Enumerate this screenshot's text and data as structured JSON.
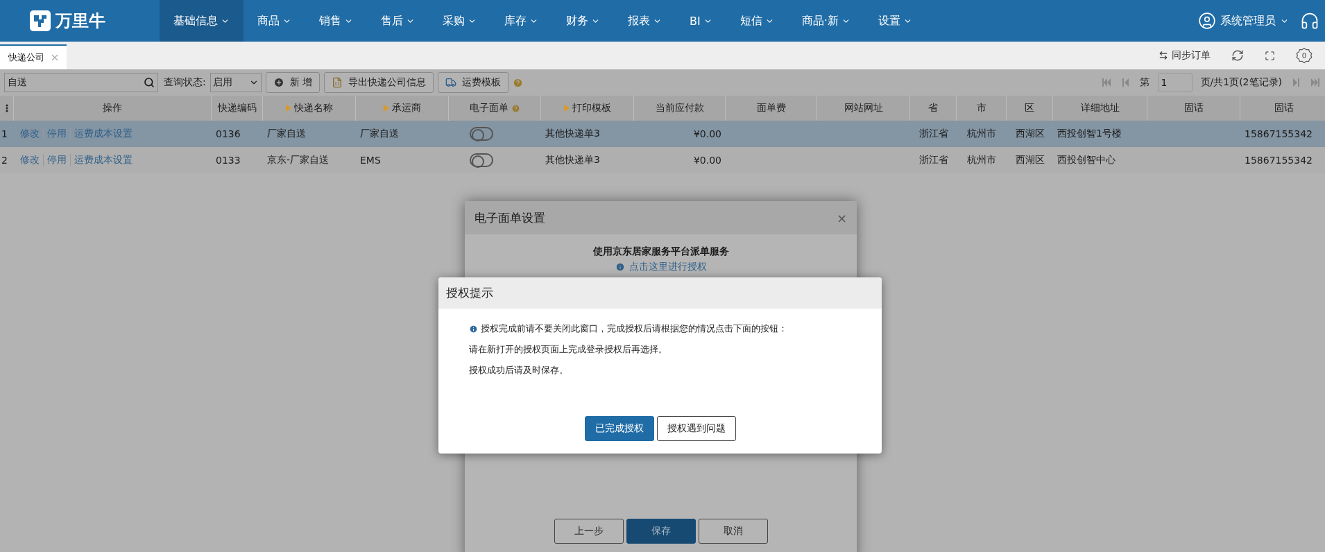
{
  "nav": {
    "logo": "万里牛",
    "items": [
      {
        "label": "基础信息",
        "selected": true
      },
      {
        "label": "商品",
        "selected": false
      },
      {
        "label": "销售",
        "selected": false
      },
      {
        "label": "售后",
        "selected": false
      },
      {
        "label": "采购",
        "selected": false
      },
      {
        "label": "库存",
        "selected": false
      },
      {
        "label": "财务",
        "selected": false
      },
      {
        "label": "报表",
        "selected": false
      },
      {
        "label": "BI",
        "selected": false
      },
      {
        "label": "短信",
        "selected": false
      },
      {
        "label": "商品·新",
        "selected": false
      },
      {
        "label": "设置",
        "selected": false
      }
    ],
    "user": "系统管理员"
  },
  "tabs": [
    {
      "label": "快递公司",
      "selected": true
    }
  ],
  "tab_actions": {
    "sync": "同步订单",
    "settings_count": "0"
  },
  "toolbar": {
    "search_value": "自送",
    "status_label": "查询状态:",
    "status_value": "启用",
    "buttons": [
      {
        "label": "新 增",
        "kind": "add"
      },
      {
        "label": "导出快递公司信息",
        "kind": "export"
      },
      {
        "label": "运费模板",
        "kind": "template"
      }
    ]
  },
  "pager": {
    "prefix": "第",
    "page": "1",
    "suffix": "页/共1页(2笔记录)"
  },
  "table": {
    "columns": [
      {
        "label": "操作",
        "marker": false,
        "help": false
      },
      {
        "label": "快递编码",
        "marker": false,
        "help": false
      },
      {
        "label": "快递名称",
        "marker": true,
        "help": false
      },
      {
        "label": "承运商",
        "marker": true,
        "help": false
      },
      {
        "label": "电子面单",
        "marker": false,
        "help": true
      },
      {
        "label": "打印模板",
        "marker": true,
        "help": false
      },
      {
        "label": "当前应付款",
        "marker": false,
        "help": false
      },
      {
        "label": "面单费",
        "marker": false,
        "help": false
      },
      {
        "label": "网站网址",
        "marker": false,
        "help": false
      },
      {
        "label": "省",
        "marker": false,
        "help": false
      },
      {
        "label": "市",
        "marker": false,
        "help": false
      },
      {
        "label": "区",
        "marker": false,
        "help": false
      },
      {
        "label": "详细地址",
        "marker": false,
        "help": false
      },
      {
        "label": "固话",
        "marker": false,
        "help": false
      },
      {
        "label": "固话",
        "marker": false,
        "help": false
      }
    ],
    "rows": [
      {
        "index": "1",
        "selected": true,
        "actions": [
          "修改",
          "停用",
          "运费成本设置"
        ],
        "code": "0136",
        "name": "厂家自送",
        "carrier": "厂家自送",
        "esheet_on": false,
        "template": "其他快递单3",
        "payable": "¥0.00",
        "province": "浙江省",
        "city": "杭州市",
        "district": "西湖区",
        "address": "西投创智1号楼",
        "phone": "15867155342"
      },
      {
        "index": "2",
        "selected": false,
        "actions": [
          "修改",
          "停用",
          "运费成本设置"
        ],
        "code": "0133",
        "name": "京东-厂家自送",
        "carrier": "EMS",
        "esheet_on": false,
        "template": "其他快递单3",
        "payable": "¥0.00",
        "province": "浙江省",
        "city": "杭州市",
        "district": "西湖区",
        "address": "西投创智中心",
        "phone": "15867155342"
      }
    ]
  },
  "back_dialog": {
    "title": "电子面单设置",
    "close": "×",
    "heading": "使用京东居家服务平台派单服务",
    "link": "点击这里进行授权",
    "buttons": [
      {
        "label": "上一步",
        "kind": "default"
      },
      {
        "label": "保存",
        "kind": "primary"
      },
      {
        "label": "取消",
        "kind": "default"
      }
    ]
  },
  "front_dialog": {
    "title": "授权提示",
    "lines": [
      {
        "text": "授权完成前请不要关闭此窗口，完成授权后请根据您的情况点击下面的按钮：",
        "kind": "info"
      },
      {
        "text": "请在新打开的授权页面上完成登录授权后再选择。",
        "kind": "plain"
      },
      {
        "text": "授权成功后请及时保存。",
        "kind": "plain"
      }
    ],
    "buttons": [
      {
        "label": "已完成授权",
        "kind": "primary"
      },
      {
        "label": "授权遇到问题",
        "kind": "default"
      }
    ]
  }
}
